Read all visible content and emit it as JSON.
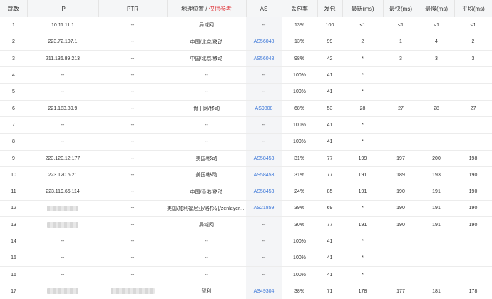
{
  "headers": {
    "hop": "跳数",
    "ip": "IP",
    "ptr": "PTR",
    "location": "地理位置 / ",
    "location_note": "仅供参考",
    "as": "AS",
    "loss": "丢包率",
    "sent": "发包",
    "last": "最新(ms)",
    "best": "最快(ms)",
    "worst": "最慢(ms)",
    "avg": "平均(ms)"
  },
  "rows": [
    {
      "hop": "1",
      "ip": "10.11.11.1",
      "ptr": "--",
      "location": "局域网",
      "as": "--",
      "loss": "13%",
      "sent": "100",
      "last": "<1",
      "best": "<1",
      "worst": "<1",
      "avg": "<1"
    },
    {
      "hop": "2",
      "ip": "223.72.107.1",
      "ptr": "--",
      "location": "中国/北京/移动",
      "as": "AS56048",
      "loss": "13%",
      "sent": "99",
      "last": "2",
      "best": "1",
      "worst": "4",
      "avg": "2"
    },
    {
      "hop": "3",
      "ip": "211.136.89.213",
      "ptr": "--",
      "location": "中国/北京/移动",
      "as": "AS56048",
      "loss": "98%",
      "sent": "42",
      "last": "*",
      "best": "3",
      "worst": "3",
      "avg": "3"
    },
    {
      "hop": "4",
      "ip": "--",
      "ptr": "--",
      "location": "--",
      "as": "--",
      "loss": "100%",
      "sent": "41",
      "last": "*",
      "best": "",
      "worst": "",
      "avg": ""
    },
    {
      "hop": "5",
      "ip": "--",
      "ptr": "--",
      "location": "--",
      "as": "--",
      "loss": "100%",
      "sent": "41",
      "last": "*",
      "best": "",
      "worst": "",
      "avg": ""
    },
    {
      "hop": "6",
      "ip": "221.183.89.9",
      "ptr": "--",
      "location": "骨干网/移动",
      "as": "AS9808",
      "loss": "68%",
      "sent": "53",
      "last": "28",
      "best": "27",
      "worst": "28",
      "avg": "27"
    },
    {
      "hop": "7",
      "ip": "--",
      "ptr": "--",
      "location": "--",
      "as": "--",
      "loss": "100%",
      "sent": "41",
      "last": "*",
      "best": "",
      "worst": "",
      "avg": ""
    },
    {
      "hop": "8",
      "ip": "--",
      "ptr": "--",
      "location": "--",
      "as": "--",
      "loss": "100%",
      "sent": "41",
      "last": "*",
      "best": "",
      "worst": "",
      "avg": ""
    },
    {
      "hop": "9",
      "ip": "223.120.12.177",
      "ptr": "--",
      "location": "美国/移动",
      "as": "AS58453",
      "loss": "31%",
      "sent": "77",
      "last": "199",
      "best": "197",
      "worst": "200",
      "avg": "198"
    },
    {
      "hop": "10",
      "ip": "223.120.6.21",
      "ptr": "--",
      "location": "美国/移动",
      "as": "AS58453",
      "loss": "31%",
      "sent": "77",
      "last": "191",
      "best": "189",
      "worst": "193",
      "avg": "190"
    },
    {
      "hop": "11",
      "ip": "223.119.66.114",
      "ptr": "--",
      "location": "中国/香港/移动",
      "as": "AS58453",
      "loss": "24%",
      "sent": "85",
      "last": "191",
      "best": "190",
      "worst": "191",
      "avg": "190"
    },
    {
      "hop": "12",
      "ip": "",
      "ptr": "--",
      "location": "美国/加利福尼亚/洛杉矶/zenlayer.com",
      "as": "AS21859",
      "loss": "39%",
      "sent": "69",
      "last": "*",
      "best": "190",
      "worst": "191",
      "avg": "190"
    },
    {
      "hop": "13",
      "ip": "",
      "ptr": "--",
      "location": "局域网",
      "as": "--",
      "loss": "30%",
      "sent": "77",
      "last": "191",
      "best": "190",
      "worst": "191",
      "avg": "190"
    },
    {
      "hop": "14",
      "ip": "--",
      "ptr": "--",
      "location": "--",
      "as": "--",
      "loss": "100%",
      "sent": "41",
      "last": "*",
      "best": "",
      "worst": "",
      "avg": ""
    },
    {
      "hop": "15",
      "ip": "--",
      "ptr": "--",
      "location": "--",
      "as": "--",
      "loss": "100%",
      "sent": "41",
      "last": "*",
      "best": "",
      "worst": "",
      "avg": ""
    },
    {
      "hop": "16",
      "ip": "--",
      "ptr": "--",
      "location": "--",
      "as": "--",
      "loss": "100%",
      "sent": "41",
      "last": "*",
      "best": "",
      "worst": "",
      "avg": ""
    },
    {
      "hop": "17",
      "ip": "",
      "ptr": "",
      "location": "智利",
      "as": "AS49304",
      "loss": "38%",
      "sent": "71",
      "last": "178",
      "best": "177",
      "worst": "181",
      "avg": "178"
    }
  ],
  "redacted_rows": [
    11,
    12,
    16
  ],
  "redacted_ptr_rows": [
    16
  ],
  "colors": {
    "accent_link": "#3a76d8",
    "note_red": "#e0393e",
    "header_bg": "#f5f6f7"
  }
}
